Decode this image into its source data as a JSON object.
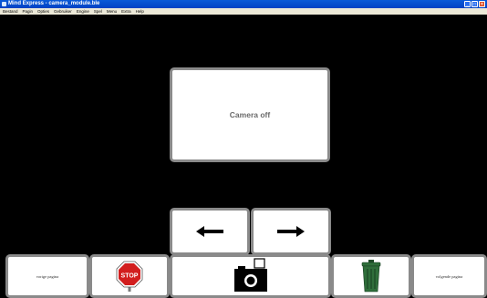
{
  "window": {
    "title": "Mind Express - camera_module.ble",
    "minimize": "_",
    "maximize": "□",
    "close": "×"
  },
  "menu": {
    "items": [
      "Bestand",
      "Pagin",
      "Opties",
      "Gebruiker",
      "Engine",
      "Spel",
      "Menu",
      "Extra",
      "Help"
    ]
  },
  "grid": {
    "camera_view_label": "Camera off",
    "prev_page_label": "vorige pagina",
    "next_page_label": "volgende pagina",
    "stop_sign_text": "STOP"
  },
  "colors": {
    "background": "#000000",
    "cell_border": "#8a8a8a",
    "stop_red": "#d21e1e",
    "bin_green": "#2f6e3a"
  }
}
